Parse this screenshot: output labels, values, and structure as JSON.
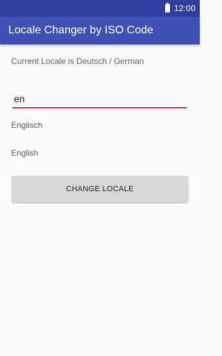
{
  "status_bar": {
    "time": "12:00",
    "battery_icon": "battery-full-icon"
  },
  "app_bar": {
    "title": "Locale Changer by ISO Code"
  },
  "content": {
    "current_locale_text": "Current Locale is Deutsch / German",
    "locale_input_value": "en",
    "language_native_name": "Englisch",
    "language_english_name": "English",
    "change_button_label": "CHANGE LOCALE"
  },
  "colors": {
    "status_bar": "#303f9f",
    "primary": "#3f51b5",
    "accent": "#e91e63",
    "button": "#d6d7d7",
    "background": "#fafafa"
  }
}
